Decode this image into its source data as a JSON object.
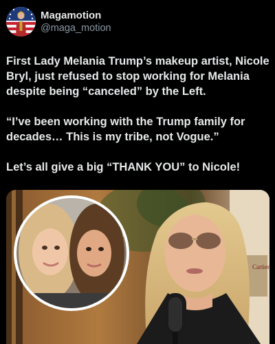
{
  "post": {
    "author": {
      "display_name": "Magamotion",
      "handle": "@maga_motion",
      "avatar_icon": "flag-avatar-icon"
    },
    "paragraphs": [
      "First Lady Melania Trump’s makeup artist, Nicole Bryl, just refused to stop working for Melania despite being “canceled” by the Left.",
      "“I’ve been working with the Trump family for decades… This is my tribe, not Vogue.”",
      "Let’s all give a big “THANK YOU” to Nicole!"
    ],
    "media": {
      "type": "photo",
      "background_sign_text": "Cartier"
    }
  },
  "colors": {
    "background": "#000000",
    "primary_text": "#e7e9ea",
    "secondary_text": "#8b98a5"
  }
}
